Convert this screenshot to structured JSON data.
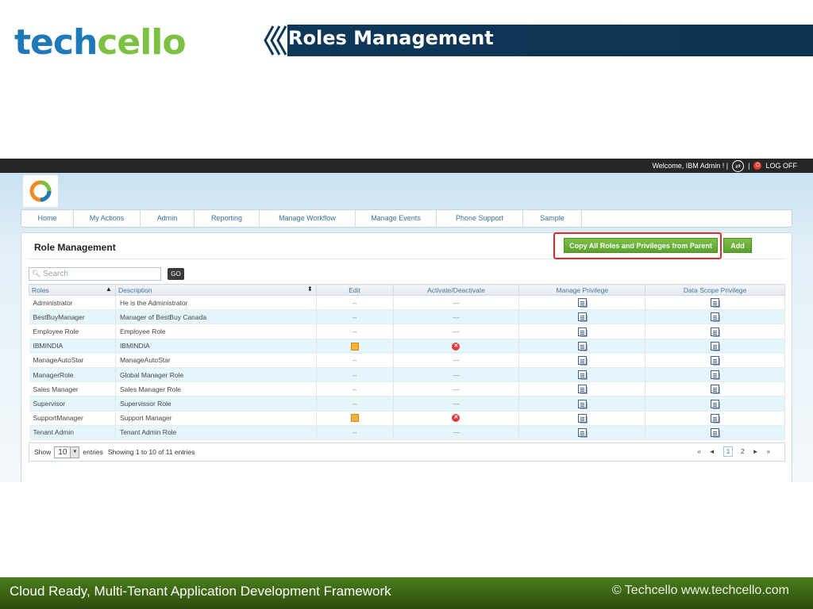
{
  "slide": {
    "logo": {
      "part1": "tech",
      "part2": "cello"
    },
    "title": "Roles Management",
    "footer_left": "Cloud Ready, Multi-Tenant Application Development Framework",
    "footer_right": "© Techcello www.techcello.com"
  },
  "app": {
    "topbar": {
      "welcome": "Welcome, IBM Admin ! |",
      "separator": "|",
      "logoff": "LOG OFF"
    },
    "nav": [
      "Home",
      "My Actions",
      "Admin",
      "Reporting",
      "Manage Workflow",
      "Manage Events",
      "Phone Support",
      "Sample"
    ],
    "panel_title": "Role Management",
    "copy_button": "Copy All Roles and Privileges from Parent",
    "add_button": "Add",
    "search_placeholder": "Search",
    "go_button": "GO",
    "columns": {
      "roles": "Roles",
      "description": "Description",
      "edit": "Edit",
      "activate": "Activate/Deactivate",
      "manage_privilege": "Manage Privilege",
      "data_scope_privilege": "Data Scope Privilege"
    },
    "rows": [
      {
        "role": "Administrator",
        "description": "He is the Administrator",
        "edit": "--",
        "activate": "---"
      },
      {
        "role": "BestBuyManager",
        "description": "Manager of BestBuy Canada",
        "edit": "--",
        "activate": "---"
      },
      {
        "role": "Employee Role",
        "description": "Employee Role",
        "edit": "--",
        "activate": "---"
      },
      {
        "role": "IBMINDIA",
        "description": "IBMINDIA",
        "edit": "",
        "activate": ""
      },
      {
        "role": "ManageAutoStar",
        "description": "ManageAutoStar",
        "edit": "--",
        "activate": "---"
      },
      {
        "role": "ManagerRole",
        "description": "Global Manager Role",
        "edit": "--",
        "activate": "---"
      },
      {
        "role": "Sales Manager",
        "description": "Sales Manager Role",
        "edit": "--",
        "activate": "---"
      },
      {
        "role": "Supervisor",
        "description": "Supervissor Role",
        "edit": "--",
        "activate": "---"
      },
      {
        "role": "SupportManager",
        "description": "Support Manager",
        "edit": "",
        "activate": ""
      },
      {
        "role": "Tenant Admin",
        "description": "Tenant Admin Role",
        "edit": "--",
        "activate": "---"
      }
    ],
    "footer": {
      "show_label": "Show",
      "show_value": "10",
      "entries_label": "entries",
      "showing_text": "Showing 1 to 10 of 11 entries",
      "pager": {
        "first": "«",
        "prev": "◄",
        "page1": "1",
        "page2": "2",
        "next": "►",
        "last": "»"
      }
    }
  },
  "colors": {
    "banner": "#0f3858",
    "footer": "#3c6514",
    "accent_green": "#5aa32b",
    "highlight_red": "#e22b2b",
    "link_blue": "#36709b"
  }
}
